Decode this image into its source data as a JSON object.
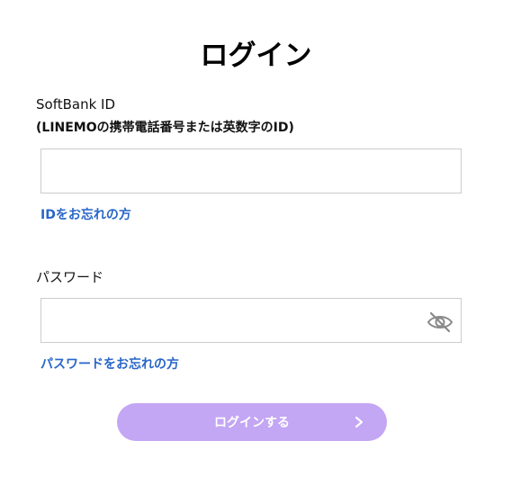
{
  "page": {
    "title": "ログイン"
  },
  "id_section": {
    "label": "SoftBank ID",
    "sublabel": "(LINEMOの携帯電話番号または英数字のID)",
    "input_value": "",
    "input_placeholder": "",
    "forgot_link": "IDをお忘れの方"
  },
  "password_section": {
    "label": "パスワード",
    "input_value": "",
    "input_placeholder": "",
    "visibility_icon": "eye-slash-icon",
    "forgot_link": "パスワードをお忘れの方"
  },
  "login_button": {
    "label": "ログインする",
    "icon": "chevron-right-icon"
  },
  "colors": {
    "link": "#2866c8",
    "button_bg": "#c3a6f4",
    "button_text": "#ffffff",
    "input_border": "#cccccc"
  }
}
